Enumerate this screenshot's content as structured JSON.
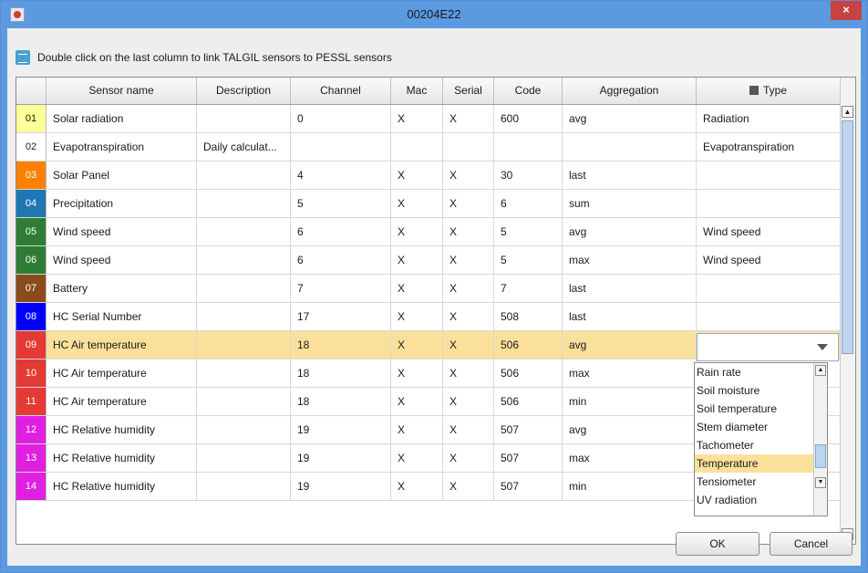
{
  "window": {
    "title": "00204E22",
    "close_glyph": "×",
    "app_icon": "java-cup-icon"
  },
  "hint": {
    "icon": "link-sensors-icon",
    "text": "Double click on the last column to link TALGIL sensors to PESSL sensors"
  },
  "table": {
    "columns": [
      "",
      "Sensor name",
      "Description",
      "Channel",
      "Mac",
      "Serial",
      "Code",
      "Aggregation",
      "Type"
    ],
    "type_icon": "sensor-type-icon",
    "rows": [
      {
        "num": "01",
        "num_bg": "#ffff99",
        "num_fg": "#1a1a1a",
        "name": "Solar radiation",
        "desc": "",
        "channel": "0",
        "mac": "X",
        "serial": "X",
        "code": "600",
        "agg": "avg",
        "type": "Radiation"
      },
      {
        "num": "02",
        "num_bg": "#ffffff",
        "num_fg": "#1a1a1a",
        "name": "Evapotranspiration",
        "desc": "Daily calculat...",
        "channel": "",
        "mac": "",
        "serial": "",
        "code": "",
        "agg": "",
        "type": "Evapotranspiration"
      },
      {
        "num": "03",
        "num_bg": "#ff8000",
        "num_fg": "#ffffff",
        "name": "Solar Panel",
        "desc": "",
        "channel": "4",
        "mac": "X",
        "serial": "X",
        "code": "30",
        "agg": "last",
        "type": ""
      },
      {
        "num": "04",
        "num_bg": "#1f77b4",
        "num_fg": "#ffffff",
        "name": "Precipitation",
        "desc": "",
        "channel": "5",
        "mac": "X",
        "serial": "X",
        "code": "6",
        "agg": "sum",
        "type": ""
      },
      {
        "num": "05",
        "num_bg": "#2e7d32",
        "num_fg": "#ffffff",
        "name": "Wind speed",
        "desc": "",
        "channel": "6",
        "mac": "X",
        "serial": "X",
        "code": "5",
        "agg": "avg",
        "type": "Wind speed"
      },
      {
        "num": "06",
        "num_bg": "#2e7d32",
        "num_fg": "#ffffff",
        "name": "Wind speed",
        "desc": "",
        "channel": "6",
        "mac": "X",
        "serial": "X",
        "code": "5",
        "agg": "max",
        "type": "Wind speed"
      },
      {
        "num": "07",
        "num_bg": "#8b4a1c",
        "num_fg": "#ffffff",
        "name": "Battery",
        "desc": "",
        "channel": "7",
        "mac": "X",
        "serial": "X",
        "code": "7",
        "agg": "last",
        "type": ""
      },
      {
        "num": "08",
        "num_bg": "#0000ff",
        "num_fg": "#ffffff",
        "name": "HC Serial Number",
        "desc": "",
        "channel": "17",
        "mac": "X",
        "serial": "X",
        "code": "508",
        "agg": "last",
        "type": ""
      },
      {
        "num": "09",
        "num_bg": "#e53935",
        "num_fg": "#ffffff",
        "name": "HC Air temperature",
        "desc": "",
        "channel": "18",
        "mac": "X",
        "serial": "X",
        "code": "506",
        "agg": "avg",
        "type": ""
      },
      {
        "num": "10",
        "num_bg": "#e53935",
        "num_fg": "#ffffff",
        "name": "HC Air temperature",
        "desc": "",
        "channel": "18",
        "mac": "X",
        "serial": "X",
        "code": "506",
        "agg": "max",
        "type": ""
      },
      {
        "num": "11",
        "num_bg": "#e53935",
        "num_fg": "#ffffff",
        "name": "HC Air temperature",
        "desc": "",
        "channel": "18",
        "mac": "X",
        "serial": "X",
        "code": "506",
        "agg": "min",
        "type": ""
      },
      {
        "num": "12",
        "num_bg": "#e020e0",
        "num_fg": "#ffffff",
        "name": "HC Relative humidity",
        "desc": "",
        "channel": "19",
        "mac": "X",
        "serial": "X",
        "code": "507",
        "agg": "avg",
        "type": ""
      },
      {
        "num": "13",
        "num_bg": "#e020e0",
        "num_fg": "#ffffff",
        "name": "HC Relative humidity",
        "desc": "",
        "channel": "19",
        "mac": "X",
        "serial": "X",
        "code": "507",
        "agg": "max",
        "type": ""
      },
      {
        "num": "14",
        "num_bg": "#e020e0",
        "num_fg": "#ffffff",
        "name": "HC Relative humidity",
        "desc": "",
        "channel": "19",
        "mac": "X",
        "serial": "X",
        "code": "507",
        "agg": "min",
        "type": ""
      }
    ],
    "selected_row": 8
  },
  "type_dropdown": {
    "items": [
      "Rain rate",
      "Soil moisture",
      "Soil temperature",
      "Stem diameter",
      "Tachometer",
      "Temperature",
      "Tensiometer",
      "UV radiation"
    ],
    "selected": "Temperature"
  },
  "buttons": {
    "ok": "OK",
    "cancel": "Cancel"
  },
  "colors": {
    "title_bar": "#5b9ae0",
    "close_button": "#c74343",
    "selection": "#fbe09c"
  }
}
